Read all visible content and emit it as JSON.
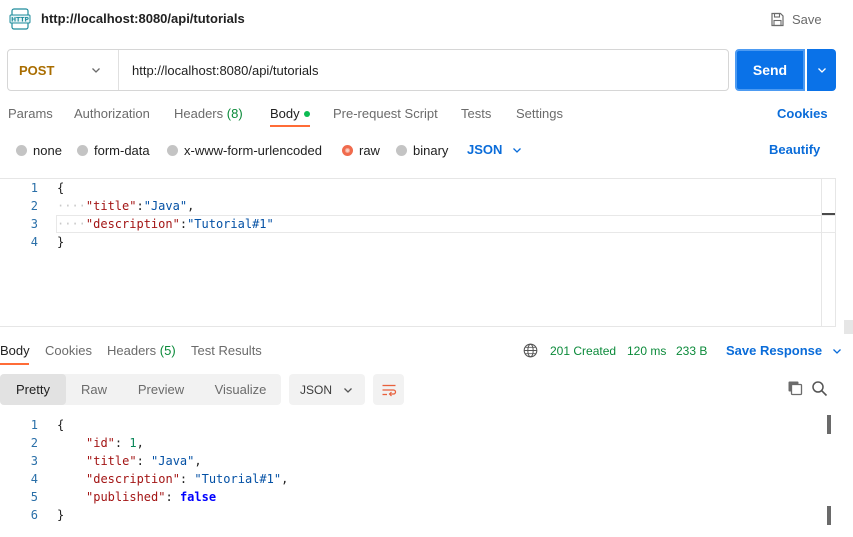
{
  "window": {
    "title": "http://localhost:8080/api/tutorials",
    "save_label": "Save",
    "icon": "http-file-icon"
  },
  "request": {
    "method": "POST",
    "url": "http://localhost:8080/api/tutorials",
    "send_label": "Send"
  },
  "request_tabs": {
    "params": "Params",
    "authorization": "Authorization",
    "headers": "Headers",
    "headers_count": "(8)",
    "body": "Body",
    "prerequest": "Pre-request Script",
    "tests": "Tests",
    "settings": "Settings",
    "cookies": "Cookies",
    "active": "Body"
  },
  "body_types": {
    "none": "none",
    "form_data": "form-data",
    "urlencoded": "x-www-form-urlencoded",
    "raw": "raw",
    "binary": "binary",
    "selected": "raw",
    "language": "JSON",
    "beautify": "Beautify"
  },
  "request_body": {
    "line_numbers": [
      "1",
      "2",
      "3",
      "4"
    ],
    "open_brace": "{",
    "close_brace": "}",
    "line2_key": "\"title\"",
    "line2_value": "\"Java\"",
    "line3_key": "\"description\"",
    "line3_value": "\"Tutorial#1\""
  },
  "response_tabs": {
    "body": "Body",
    "cookies": "Cookies",
    "headers": "Headers",
    "headers_count": "(5)",
    "test_results": "Test Results",
    "active": "Body"
  },
  "response_meta": {
    "status": "201 Created",
    "time": "120 ms",
    "size": "233 B",
    "save_response": "Save Response"
  },
  "response_view": {
    "modes": [
      "Pretty",
      "Raw",
      "Preview",
      "Visualize"
    ],
    "active_mode": "Pretty",
    "format": "JSON"
  },
  "response_body": {
    "line_numbers": [
      "1",
      "2",
      "3",
      "4",
      "5",
      "6"
    ],
    "open_brace": "{",
    "close_brace": "}",
    "id_key": "\"id\"",
    "id_value": "1",
    "title_key": "\"title\"",
    "title_value": "\"Java\"",
    "description_key": "\"description\"",
    "description_value": "\"Tutorial#1\"",
    "published_key": "\"published\"",
    "published_value": "false"
  },
  "colors": {
    "accent_blue": "#0a72e8",
    "link_blue": "#0a6cd9",
    "method_orange": "#a96d00",
    "tab_underline": "#ff6c37",
    "success_green": "#0b8a3a"
  }
}
